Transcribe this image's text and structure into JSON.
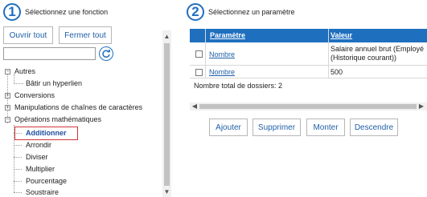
{
  "step1": {
    "number": "1",
    "title": "Sélectionnez une fonction"
  },
  "step2": {
    "number": "2",
    "title": "Sélectionnez un paramètre"
  },
  "left_panel": {
    "open_all": "Ouvrir tout",
    "close_all": "Fermer tout",
    "filter_value": ""
  },
  "tree": {
    "autres": "Autres",
    "batir": "Bâtir un hyperlien",
    "conversions": "Conversions",
    "manipulations": "Manipulations de chaînes de caractères",
    "operations": "Opérations mathématiques",
    "additionner": "Additionner",
    "arrondir": "Arrondir",
    "diviser": "Diviser",
    "multiplier": "Multiplier",
    "pourcentage": "Pourcentage",
    "soustraire": "Soustraire"
  },
  "grid": {
    "col_param": "Paramètre",
    "col_value": "Valeur",
    "rows": [
      {
        "param": "Nombre",
        "value": "Salaire annuel brut (Employé (Historique courant))"
      },
      {
        "param": "Nombre",
        "value": "500"
      }
    ],
    "total": "Nombre total de dossiers: 2"
  },
  "actions": {
    "add": "Ajouter",
    "remove": "Supprimer",
    "up": "Monter",
    "down": "Descendre"
  },
  "colors": {
    "accent": "#1f6fbf",
    "selection_border": "#d0343a",
    "link": "#1f5fa8"
  }
}
